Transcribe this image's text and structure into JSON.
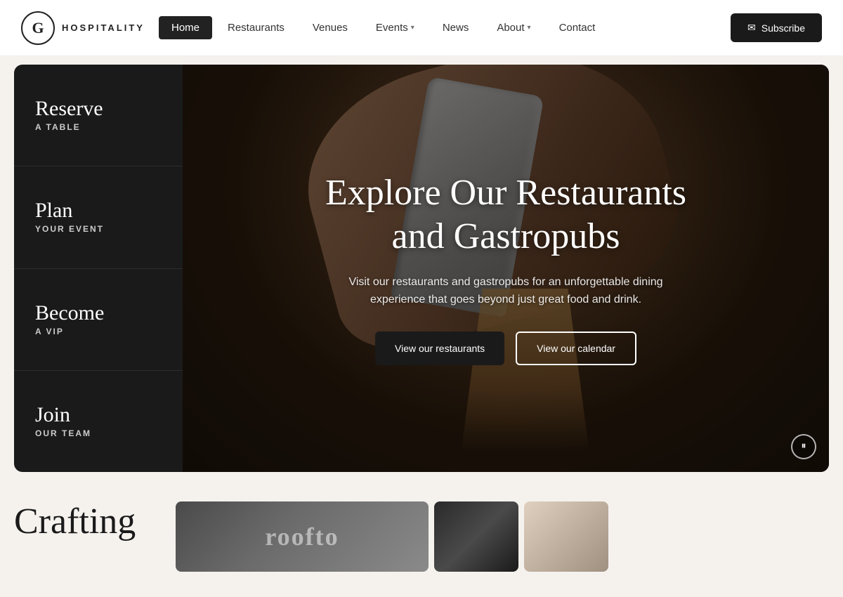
{
  "logo": {
    "letter": "G",
    "name": "HOSPITALITY"
  },
  "navbar": {
    "items": [
      {
        "label": "Home",
        "active": true,
        "hasDropdown": false
      },
      {
        "label": "Restaurants",
        "active": false,
        "hasDropdown": false
      },
      {
        "label": "Venues",
        "active": false,
        "hasDropdown": false
      },
      {
        "label": "Events",
        "active": false,
        "hasDropdown": true
      },
      {
        "label": "News",
        "active": false,
        "hasDropdown": false
      },
      {
        "label": "About",
        "active": false,
        "hasDropdown": true
      },
      {
        "label": "Contact",
        "active": false,
        "hasDropdown": false
      }
    ],
    "subscribe_label": "Subscribe"
  },
  "sidebar": {
    "items": [
      {
        "script": "Reserve",
        "upper": "A TABLE"
      },
      {
        "script": "Plan",
        "upper": "YOUR EVENT"
      },
      {
        "script": "Become",
        "upper": "A VIP"
      },
      {
        "script": "Join",
        "upper": "OUR TEAM"
      }
    ]
  },
  "hero": {
    "title_line1": "Explore Our Restaurants",
    "title_line2": "and Gastropubs",
    "subtitle": "Visit our restaurants and gastropubs for an unforgettable dining experience that goes beyond just great food and drink.",
    "btn_primary": "View our restaurants",
    "btn_secondary": "View our calendar"
  },
  "bottom": {
    "crafting_label": "Crafting",
    "rooftop_label": "roofto"
  }
}
